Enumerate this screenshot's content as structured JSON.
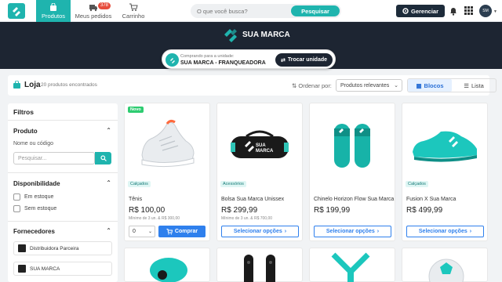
{
  "nav": {
    "tabs": [
      {
        "label": "Produtos",
        "icon": "bag-icon"
      },
      {
        "label": "Meus pedidos",
        "icon": "truck-icon",
        "badge": "378"
      },
      {
        "label": "Carrinho",
        "icon": "cart-icon"
      }
    ],
    "search": {
      "placeholder": "O que você busca?",
      "button": "Pesquisar"
    },
    "manage_button": "Gerenciar",
    "avatar_text": "SM"
  },
  "hero": {
    "brand": "SUA MARCA",
    "unit_caption": "Comprando para a unidade:",
    "unit_name": "SUA MARCA - FRANQUEADORA",
    "change_button": "Trocar unidade"
  },
  "toolbar": {
    "title": "Loja",
    "count": "20 produtos encontrados",
    "sort_label": "Ordenar por:",
    "sort_value": "Produtos relevantes",
    "view_blocks": "Blocos",
    "view_list": "Lista"
  },
  "sidebar": {
    "title": "Filtros",
    "product_section": "Produto",
    "product_sub": "Nome ou código",
    "product_placeholder": "Pesquisar...",
    "availability_section": "Disponibilidade",
    "in_stock": "Em estoque",
    "out_stock": "Sem estoque",
    "suppliers_section": "Fornecedores",
    "suppliers": [
      "Distribuidora Parceira",
      "SUA MARCA"
    ]
  },
  "products": [
    {
      "tag_new": "Novo",
      "category": "Calçados",
      "name": "Tênis",
      "price": "R$ 100,00",
      "min": "Mínimo de 3 un. & R$ 300,00",
      "qty": "0",
      "action": "Comprar"
    },
    {
      "category": "Acessórios",
      "name": "Bolsa Sua Marca Unissex",
      "price": "R$ 299,99",
      "min": "Mínimo de 3 un. & R$ 700,00",
      "action": "Selecionar opções"
    },
    {
      "name": "Chinelo Horizon Flow Sua Marca",
      "price": "R$ 199,99",
      "action": "Selecionar opções"
    },
    {
      "category": "Calçados",
      "name": "Fusion X Sua Marca",
      "price": "R$ 499,99",
      "action": "Selecionar opções"
    }
  ],
  "colors": {
    "brand": "#1fb4ae",
    "dark": "#1d2532",
    "primary": "#2f80ed"
  }
}
